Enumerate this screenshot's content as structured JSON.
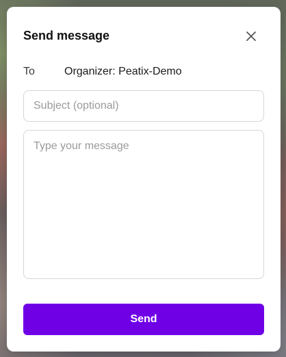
{
  "modal": {
    "title": "Send message",
    "close_icon": "close-icon",
    "to_label": "To",
    "to_value": "Organizer: Peatix-Demo",
    "subject_placeholder": "Subject (optional)",
    "subject_value": "",
    "message_placeholder": "Type your message",
    "message_value": "",
    "send_label": "Send"
  },
  "colors": {
    "accent": "#6f00e6",
    "modal_background": "#ffffff",
    "border": "#d6d6d6",
    "placeholder": "#9a9a9a"
  }
}
